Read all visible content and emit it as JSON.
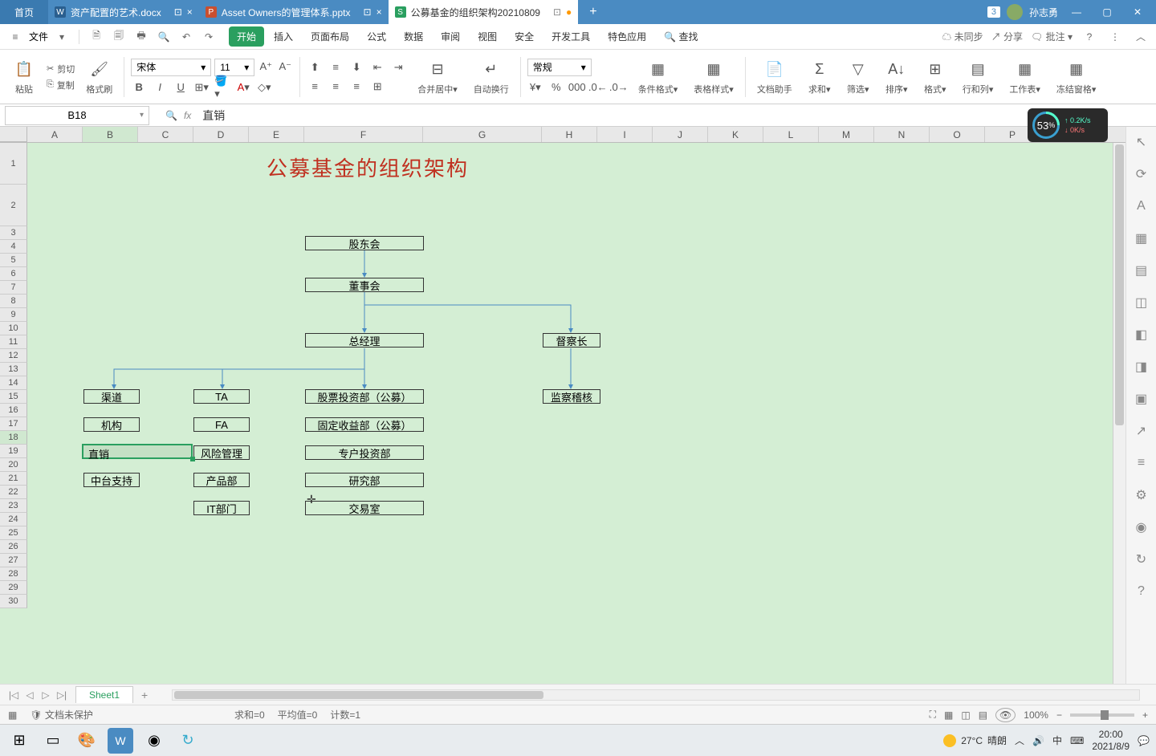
{
  "titlebar": {
    "home": "首页",
    "tabs": [
      {
        "icon": "W",
        "label": "资产配置的艺术.docx"
      },
      {
        "icon": "P",
        "label": "Asset Owners的管理体系.pptx"
      },
      {
        "icon": "S",
        "label": "公募基金的组织架构20210809"
      }
    ],
    "badge": "3",
    "user": "孙志勇"
  },
  "menubar": {
    "file": "文件",
    "tabs": [
      "开始",
      "插入",
      "页面布局",
      "公式",
      "数据",
      "审阅",
      "视图",
      "安全",
      "开发工具",
      "特色应用"
    ],
    "find_label": "查找",
    "sync": "未同步",
    "share": "分享",
    "annotate": "批注"
  },
  "ribbon": {
    "paste": "粘贴",
    "cut": "剪切",
    "copy": "复制",
    "format_painter": "格式刷",
    "font_name": "宋体",
    "font_size": "11",
    "merge_center": "合并居中",
    "wrap": "自动换行",
    "number_format": "常规",
    "cond_fmt": "条件格式",
    "table_style": "表格样式",
    "doc_helper": "文档助手",
    "sum": "求和",
    "filter": "筛选",
    "sort": "排序",
    "format": "格式",
    "rowcol": "行和列",
    "worksheet": "工作表",
    "freeze": "冻结窗格"
  },
  "formulabar": {
    "namebox": "B18",
    "formula": "直销"
  },
  "columns": [
    "A",
    "B",
    "C",
    "D",
    "E",
    "F",
    "G",
    "H",
    "I",
    "J",
    "K",
    "L",
    "M",
    "N",
    "O",
    "P"
  ],
  "rows_special": {
    "1": 52,
    "2": 52
  },
  "org": {
    "title": "公募基金的组织架构",
    "shareholders": "股东会",
    "board": "董事会",
    "gm": "总经理",
    "supervisor": "督察长",
    "channel": "渠道",
    "institution": "机构",
    "direct": "直销",
    "mid_support": "中台支持",
    "ta": "TA",
    "fa": "FA",
    "risk": "风险管理",
    "product": "产品部",
    "it": "IT部门",
    "equity": "股票投资部（公募）",
    "fixed": "固定收益部（公募）",
    "special": "专户投资部",
    "research": "研究部",
    "trading": "交易室",
    "audit": "监察稽核"
  },
  "sheetbar": {
    "sheet1": "Sheet1"
  },
  "statusbar": {
    "protect": "文档未保护",
    "sum": "求和=0",
    "avg": "平均值=0",
    "count": "计数=1",
    "zoom": "100%"
  },
  "taskbar": {
    "weather_temp": "27°C",
    "weather_cond": "晴朗",
    "ime": "中",
    "time": "20:00",
    "date": "2021/8/9"
  },
  "float": {
    "pct": "53",
    "pct_suffix": "%",
    "up": "0.2K/s",
    "dn": "0K/s"
  }
}
